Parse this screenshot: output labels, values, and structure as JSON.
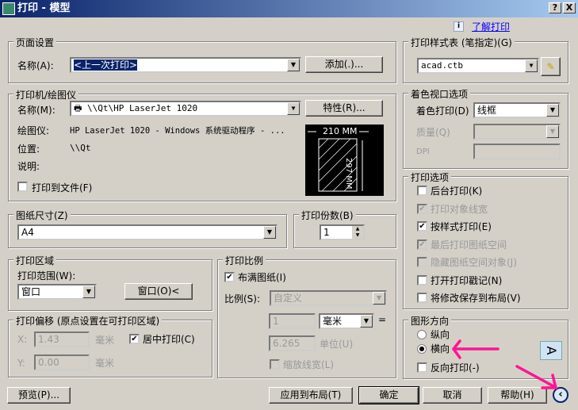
{
  "window": {
    "title": "打印 - 模型",
    "help_btn": "?",
    "close_btn": "X"
  },
  "learn_link": "了解打印",
  "page_setup": {
    "legend": "页面设置",
    "name_label": "名称(A):",
    "name_value": "<上一次打印>",
    "add_button": "添加(.)..."
  },
  "printer": {
    "legend": "打印机/绘图仪",
    "name_label": "名称(M):",
    "name_value": "\\\\Qt\\HP LaserJet 1020",
    "properties_button": "特性(R)...",
    "plotter_label": "绘图仪:",
    "plotter_value": "HP LaserJet 1020 - Windows 系统驱动程序 - ...",
    "location_label": "位置:",
    "location_value": "\\\\Qt",
    "desc_label": "说明:",
    "print_to_file": "打印到文件(F)",
    "preview_width": "210 MM",
    "preview_height": "297 MM"
  },
  "paper_size": {
    "legend": "图纸尺寸(Z)",
    "value": "A4"
  },
  "copies": {
    "legend": "打印份数(B)",
    "value": "1"
  },
  "plot_area": {
    "legend": "打印区域",
    "range_label": "打印范围(W):",
    "range_value": "窗口",
    "window_button": "窗口(O)<"
  },
  "offset": {
    "legend": "打印偏移 (原点设置在可打印区域)",
    "x_label": "X:",
    "x_value": "1.43",
    "x_unit": "毫米",
    "y_label": "Y:",
    "y_value": "0.00",
    "y_unit": "毫米",
    "center_label": "居中打印(C)"
  },
  "scale": {
    "legend": "打印比例",
    "fit_label": "布满图纸(I)",
    "scale_label": "比例(S):",
    "scale_value": "自定义",
    "value1": "1",
    "unit_value": "毫米",
    "equals": "=",
    "value2": "6.265",
    "unit_label": "单位(U)",
    "lineweight_label": "缩放线宽(L)"
  },
  "style_table": {
    "legend": "打印样式表 (笔指定)(G)",
    "value": "acad.ctb"
  },
  "shaded": {
    "legend": "着色视口选项",
    "shade_label": "着色打印(D)",
    "shade_value": "线框",
    "quality_label": "质量(Q)",
    "dpi_label": "DPI"
  },
  "options": {
    "legend": "打印选项",
    "items": [
      {
        "label": "后台打印(K)",
        "checked": false,
        "disabled": false
      },
      {
        "label": "打印对象线宽",
        "checked": true,
        "disabled": true
      },
      {
        "label": "按样式打印(E)",
        "checked": true,
        "disabled": false
      },
      {
        "label": "最后打印图纸空间",
        "checked": true,
        "disabled": true
      },
      {
        "label": "隐藏图纸空间对象(J)",
        "checked": false,
        "disabled": true
      },
      {
        "label": "打开打印戳记(N)",
        "checked": false,
        "disabled": false
      },
      {
        "label": "将修改保存到布局(V)",
        "checked": false,
        "disabled": false
      }
    ]
  },
  "orientation": {
    "legend": "图形方向",
    "portrait": "纵向",
    "landscape": "横向",
    "reverse": "反向打印(-)",
    "selected": "landscape",
    "icon_letter": "A"
  },
  "buttons": {
    "preview": "预览(P)...",
    "apply": "应用到布局(T)",
    "ok": "确定",
    "cancel": "取消",
    "help": "帮助(H)"
  },
  "colors": {
    "annotation": "#ff1493",
    "title_bar": "#0a246a"
  }
}
